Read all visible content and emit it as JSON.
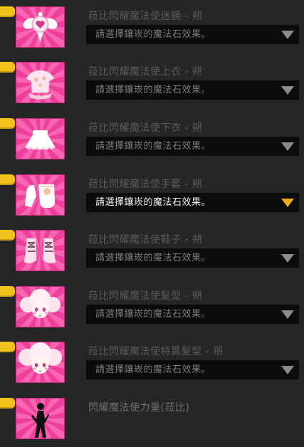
{
  "select_placeholder": "請選擇鑲崁的魔法石效果。",
  "items": [
    {
      "name": "菈比閃耀魔法使迷鏡 - 朔",
      "icon": "magic-mirror-icon",
      "has_select": true,
      "active": false
    },
    {
      "name": "菈比閃耀魔法使上衣 - 朔",
      "icon": "top-garment-icon",
      "has_select": true,
      "active": false
    },
    {
      "name": "菈比閃耀魔法使下衣 - 朔",
      "icon": "skirt-icon",
      "has_select": true,
      "active": false
    },
    {
      "name": "菈比閃耀魔法使手套 - 朔",
      "icon": "gloves-icon",
      "has_select": true,
      "active": true
    },
    {
      "name": "菈比閃耀魔法使鞋子 - 朔",
      "icon": "shoes-icon",
      "has_select": true,
      "active": false
    },
    {
      "name": "菈比閃耀魔法使髮型 - 朔",
      "icon": "hairstyle-icon",
      "has_select": true,
      "active": false
    },
    {
      "name": "菈比閃耀魔法使特異髮型 - 朔",
      "icon": "special-hairstyle-icon",
      "has_select": true,
      "active": false
    },
    {
      "name": "閃耀魔法使力量(菈比)",
      "icon": "silhouette-icon",
      "has_select": false,
      "active": false
    }
  ],
  "colors": {
    "background": "#262626",
    "corner_tab": "#f2c21c",
    "icon_pink": "#ee3f9b",
    "select_bg": "#0b0b0b",
    "arrow_active": "#f0a819",
    "arrow_idle": "#8b8b8b"
  }
}
